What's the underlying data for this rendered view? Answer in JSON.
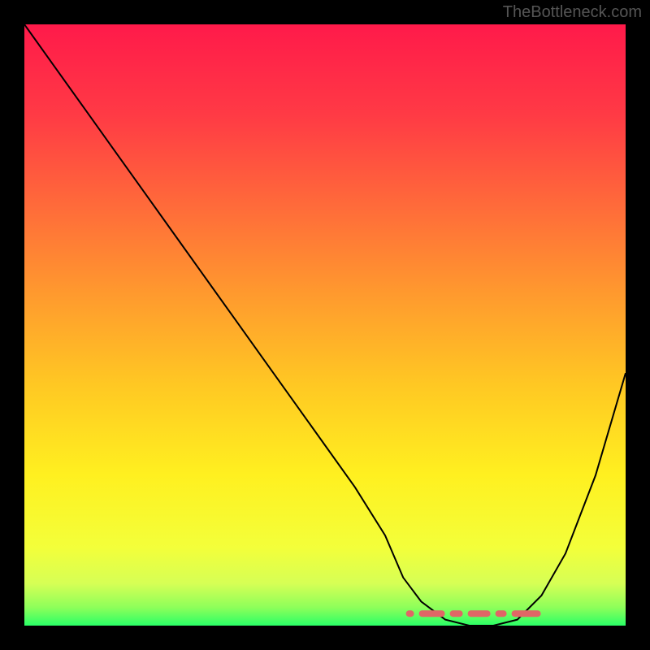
{
  "watermark": "TheBottleneck.com",
  "chart_data": {
    "type": "line",
    "title": "",
    "xlabel": "",
    "ylabel": "",
    "xlim": [
      0,
      100
    ],
    "ylim": [
      0,
      100
    ],
    "series": [
      {
        "name": "bottleneck-curve",
        "x": [
          0,
          5,
          10,
          15,
          20,
          25,
          30,
          35,
          40,
          45,
          50,
          55,
          60,
          63,
          66,
          70,
          74,
          78,
          82,
          86,
          90,
          95,
          100
        ],
        "y": [
          100,
          93,
          86,
          79,
          72,
          65,
          58,
          51,
          44,
          37,
          30,
          23,
          15,
          8,
          4,
          1,
          0,
          0,
          1,
          5,
          12,
          25,
          42
        ]
      },
      {
        "name": "optimal-zone",
        "x": [
          64,
          86
        ],
        "y": [
          2,
          2
        ]
      }
    ],
    "gradient_stops": [
      {
        "offset": 0,
        "color": "#ff1a4a"
      },
      {
        "offset": 15,
        "color": "#ff3a45"
      },
      {
        "offset": 30,
        "color": "#ff6a3a"
      },
      {
        "offset": 45,
        "color": "#ff9a2e"
      },
      {
        "offset": 60,
        "color": "#ffc823"
      },
      {
        "offset": 75,
        "color": "#fff020"
      },
      {
        "offset": 87,
        "color": "#f3ff3a"
      },
      {
        "offset": 93,
        "color": "#d6ff55"
      },
      {
        "offset": 97,
        "color": "#8dff5a"
      },
      {
        "offset": 100,
        "color": "#2aff66"
      }
    ],
    "optimal_marker_color": "#e06666"
  }
}
